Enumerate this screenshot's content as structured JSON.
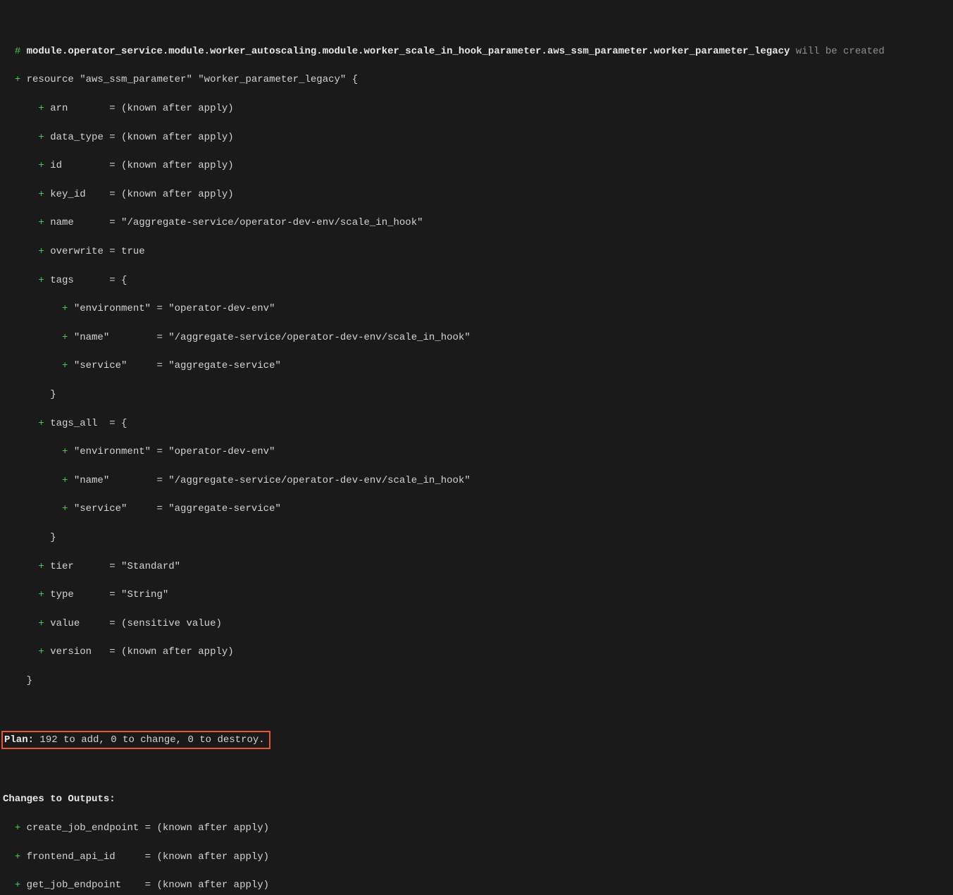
{
  "header": {
    "hash": "#",
    "resource_path": " module.operator_service.module.worker_autoscaling.module.worker_scale_in_hook_parameter.aws_ssm_parameter.worker_parameter_legacy",
    "will_be_created": " will be created"
  },
  "resource_decl": {
    "plus": "+",
    "text": " resource \"aws_ssm_parameter\" \"worker_parameter_legacy\" {"
  },
  "attrs": {
    "arn": {
      "indent": "      ",
      "plus": "+",
      "text": " arn       = (known after apply)"
    },
    "data_type": {
      "indent": "      ",
      "plus": "+",
      "text": " data_type = (known after apply)"
    },
    "id": {
      "indent": "      ",
      "plus": "+",
      "text": " id        = (known after apply)"
    },
    "key_id": {
      "indent": "      ",
      "plus": "+",
      "text": " key_id    = (known after apply)"
    },
    "name": {
      "indent": "      ",
      "plus": "+",
      "text": " name      = \"/aggregate-service/operator-dev-env/scale_in_hook\""
    },
    "overwrite": {
      "indent": "      ",
      "plus": "+",
      "text": " overwrite = true"
    },
    "tags_open": {
      "indent": "      ",
      "plus": "+",
      "text": " tags      = {"
    },
    "tags_env": {
      "indent": "          ",
      "plus": "+",
      "text": " \"environment\" = \"operator-dev-env\""
    },
    "tags_name": {
      "indent": "          ",
      "plus": "+",
      "text": " \"name\"        = \"/aggregate-service/operator-dev-env/scale_in_hook\""
    },
    "tags_svc": {
      "indent": "          ",
      "plus": "+",
      "text": " \"service\"     = \"aggregate-service\""
    },
    "tags_close": {
      "text": "        }"
    },
    "tags_all_open": {
      "indent": "      ",
      "plus": "+",
      "text": " tags_all  = {"
    },
    "tags_all_env": {
      "indent": "          ",
      "plus": "+",
      "text": " \"environment\" = \"operator-dev-env\""
    },
    "tags_all_name": {
      "indent": "          ",
      "plus": "+",
      "text": " \"name\"        = \"/aggregate-service/operator-dev-env/scale_in_hook\""
    },
    "tags_all_svc": {
      "indent": "          ",
      "plus": "+",
      "text": " \"service\"     = \"aggregate-service\""
    },
    "tags_all_close": {
      "text": "        }"
    },
    "tier": {
      "indent": "      ",
      "plus": "+",
      "text": " tier      = \"Standard\""
    },
    "type": {
      "indent": "      ",
      "plus": "+",
      "text": " type      = \"String\""
    },
    "value": {
      "indent": "      ",
      "plus": "+",
      "text": " value     = (sensitive value)"
    },
    "version": {
      "indent": "      ",
      "plus": "+",
      "text": " version   = (known after apply)"
    }
  },
  "close_brace": {
    "text": "    }"
  },
  "plan": {
    "label": "Plan:",
    "summary": " 192 to add, 0 to change, 0 to destroy."
  },
  "outputs_header": "Changes to Outputs:",
  "outputs": {
    "create_job": {
      "indent": "  ",
      "plus": "+",
      "text": " create_job_endpoint = (known after apply)"
    },
    "frontend": {
      "indent": "  ",
      "plus": "+",
      "text": " frontend_api_id     = (known after apply)"
    },
    "get_job": {
      "indent": "  ",
      "plus": "+",
      "text": " get_job_endpoint    = (known after apply)"
    }
  }
}
